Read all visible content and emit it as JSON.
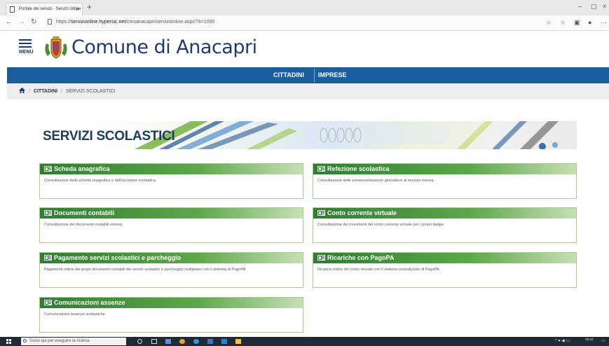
{
  "browser": {
    "tab_title": "Portale dei servizi - Servizi online",
    "tab_close": "×",
    "new_tab": "+",
    "url_prefix": "https://",
    "url_host": "servizionline.hypersic.net",
    "url_path": "/cmsanacapri/servizionline.aspx?S=1000",
    "window_min": "–",
    "window_max": "▢",
    "window_close": "×"
  },
  "site": {
    "menu_label": "MENU",
    "title": "Comune di Anacapri"
  },
  "nav": {
    "items": [
      {
        "label": "CITTADINI"
      },
      {
        "label": "IMPRESE"
      }
    ]
  },
  "breadcrumb": {
    "level1": "CITTADINI",
    "separator": "/",
    "level2": "SERVIZI SCOLASTICI"
  },
  "banner": {
    "title": "SERVIZI SCOLASTICI"
  },
  "services": [
    {
      "title": "Scheda anagrafica",
      "description": "Consultazione della scheda anagrafica e dell'iscrizione scolastica."
    },
    {
      "title": "Refezione scolastica",
      "description": "Consultazione delle presenze/assenze giornaliere al servizio mensa."
    },
    {
      "title": "Documenti contabili",
      "description": "Consultazione dei documenti contabili emessi."
    },
    {
      "title": "Conto corrente virtuale",
      "description": "Consultazione dei movimenti del conto corrente virtuale per i propri badge."
    },
    {
      "title": "Pagamento servizi scolastici e parcheggio",
      "description": "Pagamenti online dei propri documenti contabili dei servizi scolastici e parcheggio multipiano con il sistema di PagoPA."
    },
    {
      "title": "Ricariche con PagoPA",
      "description": "Ricarica online del conto virtuale con il sistema centralizzato di PagoPA."
    },
    {
      "title": "Comunicazioni assenze",
      "description": "Comunicazioni assenze scolastiche"
    }
  ],
  "taskbar": {
    "search_placeholder": "Scrivi qui per eseguire la ricerca",
    "time": "09:32"
  },
  "colors": {
    "brand_blue": "#1f3a6e",
    "nav_blue": "#1a5f9c",
    "card_green": "#2f7d32"
  }
}
